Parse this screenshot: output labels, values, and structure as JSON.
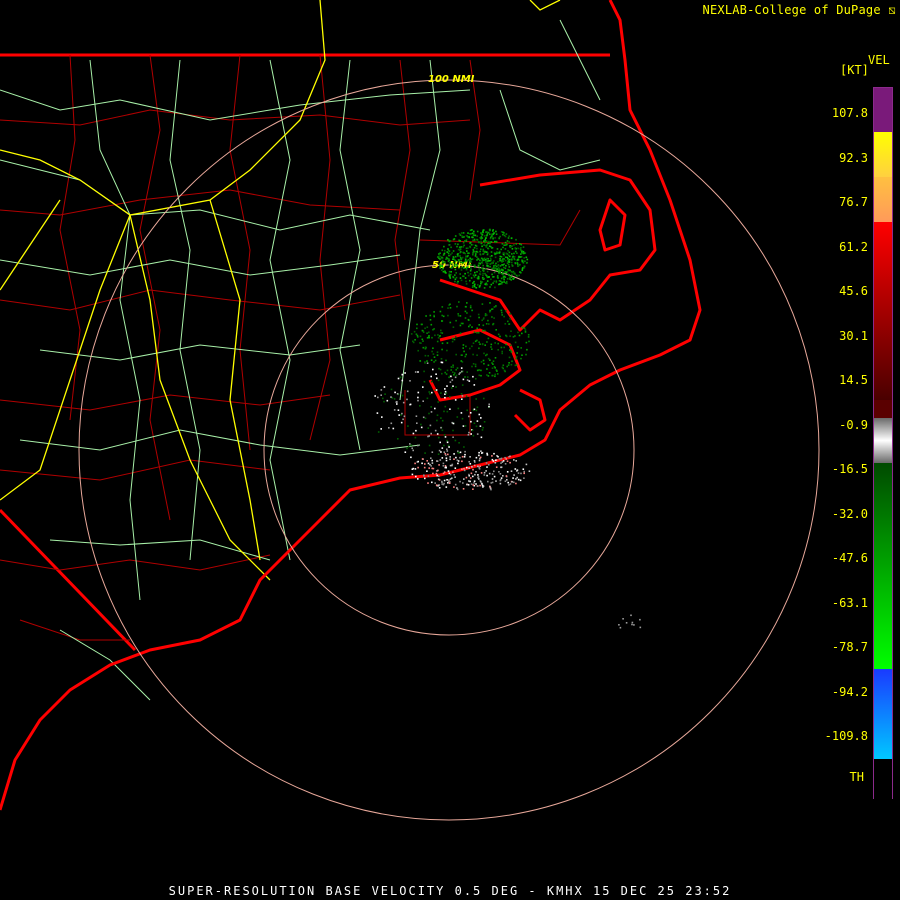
{
  "header": {
    "credit": "NEXLAB-College of DuPage ⧅"
  },
  "legend": {
    "product": "VEL",
    "unit": "[KT]",
    "ticks": [
      "107.8",
      "92.3",
      "76.7",
      "61.2",
      "45.6",
      "30.1",
      "14.5",
      "-0.9",
      "-16.5",
      "-32.0",
      "-47.6",
      "-63.1",
      "-78.7",
      "-94.2",
      "-109.8",
      "TH"
    ],
    "colors": {
      "top": "#7a1a7a",
      "yellow": "#ffff00",
      "orange": "#ff9a5a",
      "red": "#ff0000",
      "dark_red": "#4a0000",
      "gray": "#9a9a9a",
      "green": "#00ff00",
      "dark_green": "#004a00",
      "blue": "#1a5aff",
      "light_blue": "#00c8ff"
    }
  },
  "map": {
    "range_rings": [
      "100 NMI",
      "50 NMI"
    ],
    "colors": {
      "coast": "#ff0000",
      "county": "#b00000",
      "highway": "#a8f0a8",
      "interstate": "#ffff00",
      "ring": "#e8a89a"
    }
  },
  "footer": {
    "title": "SUPER-RESOLUTION BASE VELOCITY 0.5 DEG - KMHX 15 DEC 25 23:52"
  }
}
